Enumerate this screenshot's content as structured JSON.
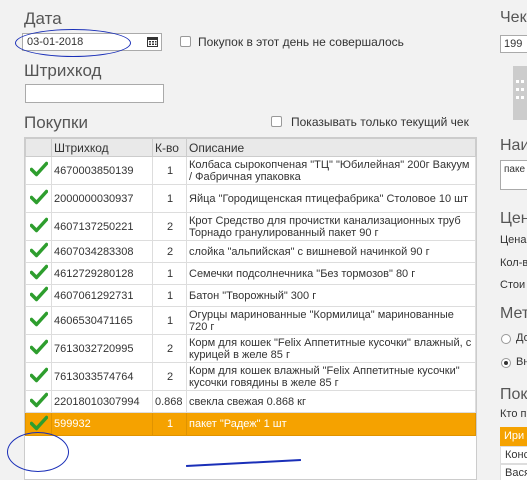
{
  "form": {
    "date_label": "Дата",
    "date_value": "03-01-2018",
    "no_purchases_label": "Покупок в этот день не совершалось",
    "barcode_label": "Штрихкод",
    "barcode_value": "",
    "purchases_label": "Покупки",
    "only_current_label": "Показывать только текущий чек"
  },
  "table": {
    "headers": [
      "",
      "Штрихкод",
      "К-во",
      "Описание"
    ],
    "rows": [
      {
        "barcode": "4670003850139",
        "qty": "1",
        "desc": "Колбаса сырокопченая \"ТЦ\" \"Юбилейная\" 200г Вакуум / Фабричная упаковка"
      },
      {
        "barcode": "2000000030937",
        "qty": "1",
        "desc": "Яйца \"Городищенская птицефабрика\" Столовое 10 шт"
      },
      {
        "barcode": "4607137250221",
        "qty": "2",
        "desc": "Крот Средство для прочистки канализационных труб Торнадо гранулированный пакет 90 г"
      },
      {
        "barcode": "4607034283308",
        "qty": "2",
        "desc": "слойка \"альпийская\" с вишневой начинкой 90 г"
      },
      {
        "barcode": "4612729280128",
        "qty": "1",
        "desc": "Семечки подсолнечника \"Без тормозов\" 80 г"
      },
      {
        "barcode": "4607061292731",
        "qty": "1",
        "desc": "Батон \"Творожный\" 300 г"
      },
      {
        "barcode": "4606530471165",
        "qty": "1",
        "desc": "Огурцы маринованные \"Кормилица\" маринованные 720 г"
      },
      {
        "barcode": "7613032720995",
        "qty": "2",
        "desc": "Корм для кошек \"Felix Аппетитные кусочки\" влажный, с курицей в желе 85 г"
      },
      {
        "barcode": "7613033574764",
        "qty": "2",
        "desc": "Корм для кошек влажный \"Felix Аппетитные кусочки\" кусочки говядины в желе 85 г"
      },
      {
        "barcode": "22018010307994",
        "qty": "0.868",
        "desc": "свекла свежая 0.868 кг"
      },
      {
        "barcode": "599932",
        "qty": "1",
        "desc": "пакет \"Радеж\" 1 шт"
      }
    ]
  },
  "right_panel": {
    "top_heading": "Чек",
    "top_value": "199",
    "name_heading": "Наи",
    "name_value": "паке",
    "price_heading": "Цен",
    "price_label": "Цена",
    "qty_label": "Кол-в",
    "cost_label": "Стои",
    "method_heading": "Мет",
    "radio1_label": "До",
    "radio2_label": "Вн",
    "buyers_heading": "Пок",
    "buyers_sub": "Кто п",
    "buyer1": "Ири",
    "buyer2": "Конс",
    "buyer3": "Вася"
  },
  "colors": {
    "selected_row": "#f5a200",
    "check_green": "#2e9e2e",
    "annotation": "#1a2fb8"
  }
}
